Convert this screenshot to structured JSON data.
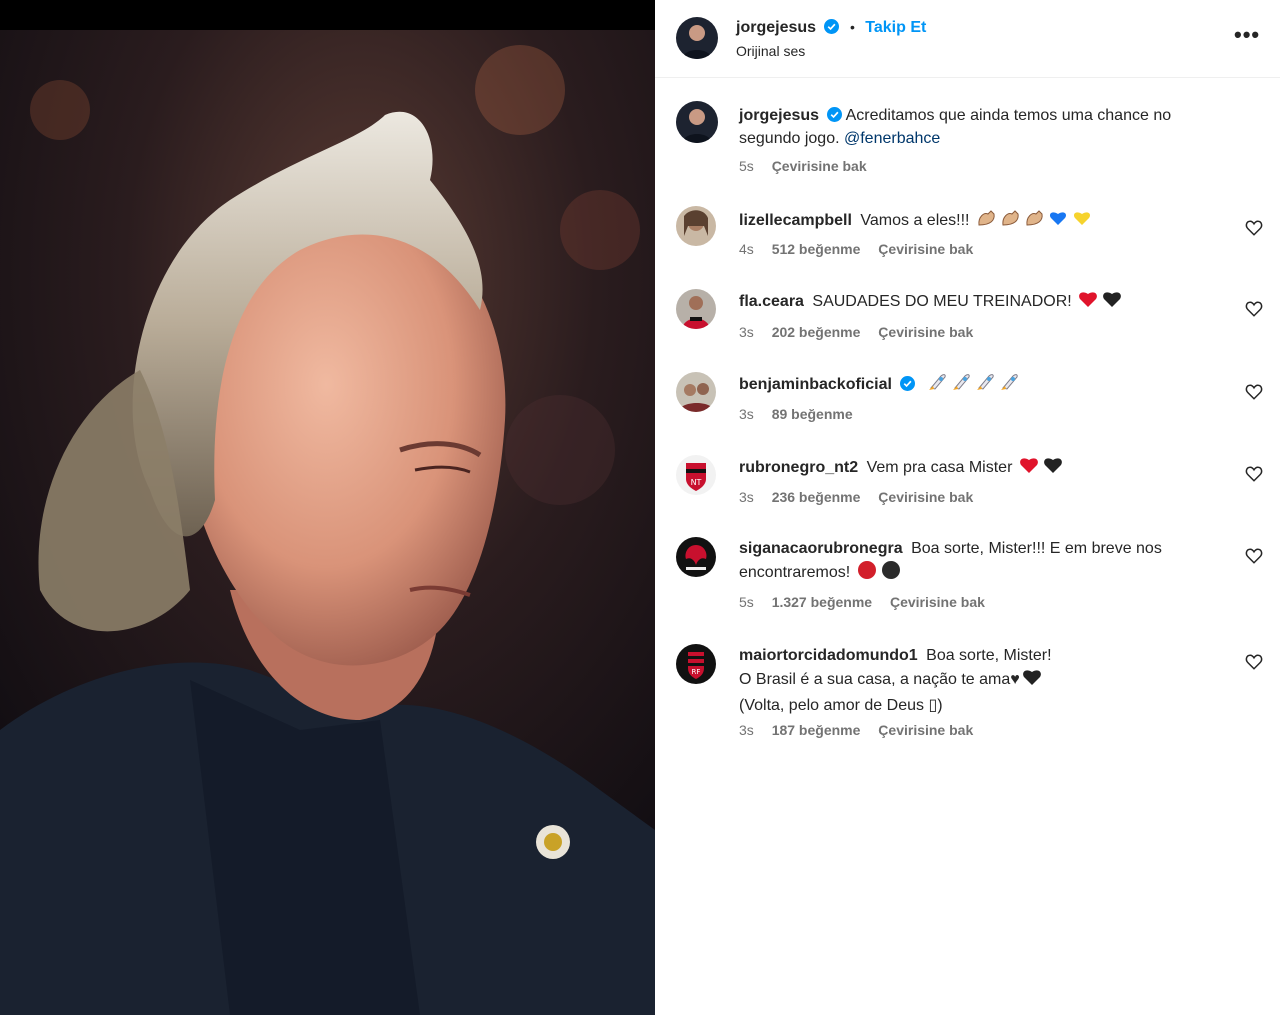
{
  "post": {
    "username": "jorgejesus",
    "follow_label": "Takip Et",
    "audio_label": "Orijinal ses",
    "more_label": "•••"
  },
  "caption": {
    "username": "jorgejesus",
    "text": "Acreditamos que ainda temos uma chance no segundo jogo.",
    "mention": "@fenerbahce",
    "time": "5s",
    "translate": "Çevirisine bak"
  },
  "comments": [
    {
      "username": "lizellecampbell",
      "verified": false,
      "text": "Vamos a eles!!!",
      "time": "4s",
      "likes": "512 beğenme",
      "translate": "Çevirisine bak"
    },
    {
      "username": "fla.ceara",
      "verified": false,
      "text": "SAUDADES DO MEU TREINADOR!",
      "time": "3s",
      "likes": "202 beğenme",
      "translate": "Çevirisine bak"
    },
    {
      "username": "benjaminbackoficial",
      "verified": true,
      "text": "",
      "time": "3s",
      "likes": "89 beğenme",
      "translate": ""
    },
    {
      "username": "rubronegro_nt2",
      "verified": false,
      "text": "Vem pra casa Mister",
      "time": "3s",
      "likes": "236 beğenme",
      "translate": "Çevirisine bak"
    },
    {
      "username": "siganacaorubronegra",
      "verified": false,
      "text": "Boa sorte, Mister!!! E em breve nos encontraremos!",
      "time": "5s",
      "likes": "1.327 beğenme",
      "translate": "Çevirisine bak"
    },
    {
      "username": "maiortorcidadomundo1",
      "verified": false,
      "text": "Boa sorte, Mister!",
      "text2": "O Brasil é a sua casa, a nação te ama♥",
      "text3": "(Volta, pelo amor de Deus ▯)",
      "time": "3s",
      "likes": "187 beğenme",
      "translate": "Çevirisine bak"
    }
  ],
  "colors": {
    "link": "#0095f6",
    "meta": "#737373",
    "text": "#262626",
    "verified": "#0095f6"
  }
}
